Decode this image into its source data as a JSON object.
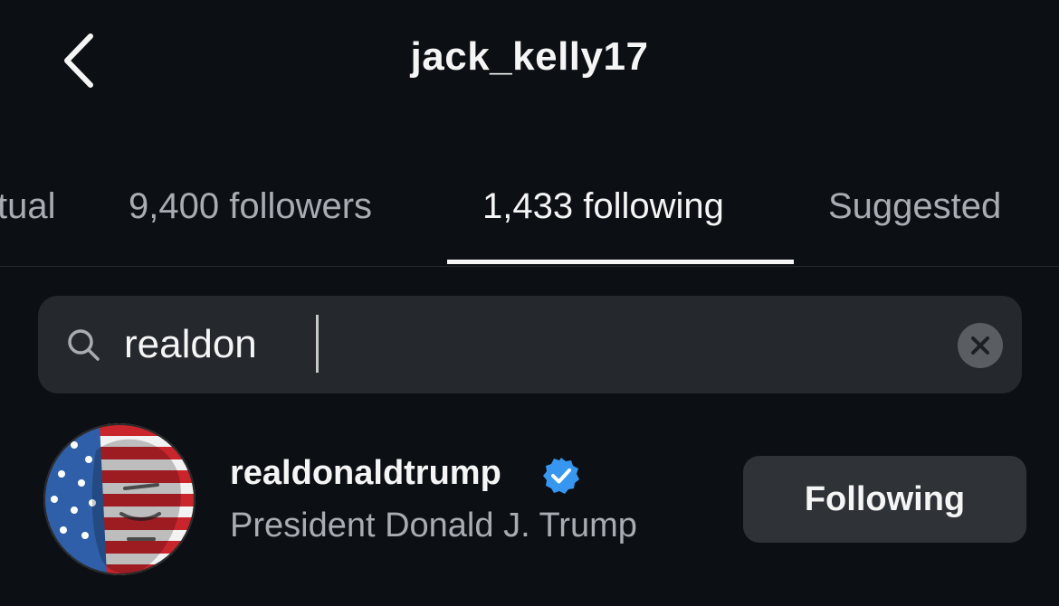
{
  "header": {
    "title": "jack_kelly17",
    "back_icon": "chevron-left-icon"
  },
  "tabs": [
    {
      "label": "Mutual",
      "visible_text": "tual",
      "active": false
    },
    {
      "label": "9,400 followers",
      "active": false
    },
    {
      "label": "1,433 following",
      "active": true
    },
    {
      "label": "Suggested",
      "active": false
    }
  ],
  "search": {
    "icon": "search-icon",
    "value": "realdon",
    "clear_icon": "close-icon"
  },
  "results": [
    {
      "username": "realdonaldtrump",
      "verified": true,
      "full_name": "President Donald J. Trump",
      "button_label": "Following"
    }
  ],
  "colors": {
    "background": "#0c1014",
    "search_bg": "#25292e",
    "button_bg": "#2f3338",
    "verified_blue": "#3797f0",
    "secondary_text": "#a8acb3"
  }
}
